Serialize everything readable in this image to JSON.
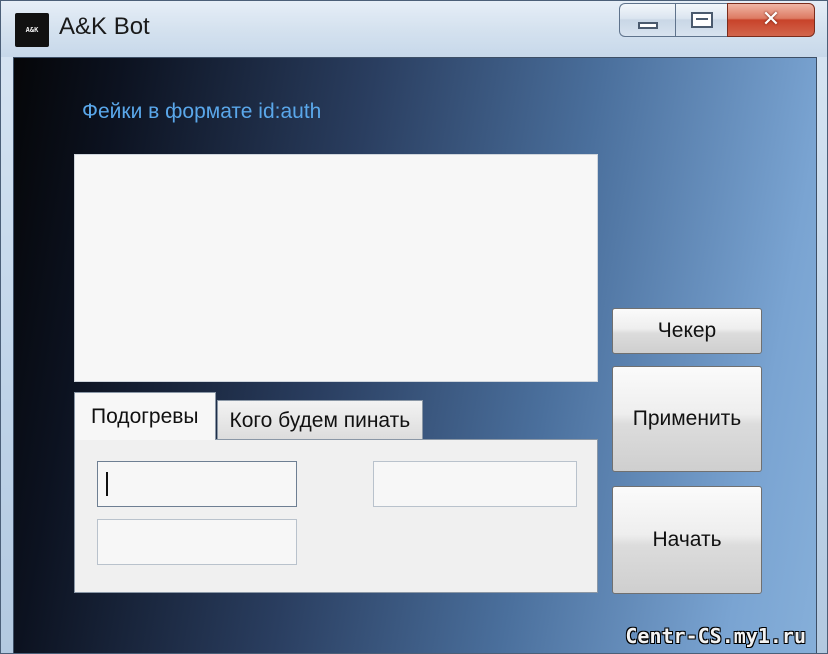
{
  "window": {
    "title": "A&K Bot",
    "icon_text": "A&K",
    "icon_name": "app-logo-icon",
    "buttons": {
      "minimize_icon": "minimize-icon",
      "maximize_icon": "maximize-icon",
      "close_glyph": "✕"
    }
  },
  "main": {
    "fakes_label": "Фейки в формате id:auth",
    "fakes_text": "",
    "tabs": [
      {
        "label": "Подогревы",
        "active": true
      },
      {
        "label": "Кого будем пинать",
        "active": false
      }
    ],
    "fields": {
      "field_1": "",
      "field_2": "",
      "field_3": ""
    }
  },
  "actions": {
    "checker_label": "Чекер",
    "apply_label": "Применить",
    "start_label": "Начать"
  },
  "watermark": "Centr-CS.my1.ru",
  "colors": {
    "label_accent": "#5aa7ea",
    "close_button": "#c8432a"
  }
}
